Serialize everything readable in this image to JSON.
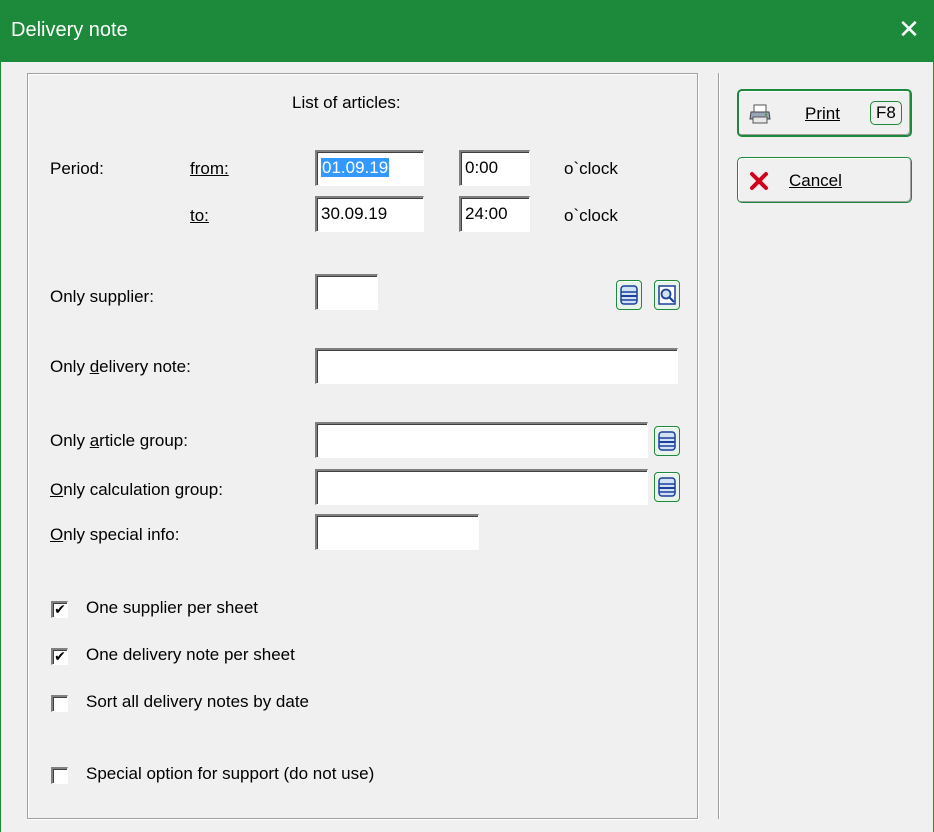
{
  "window": {
    "title": "Delivery note",
    "close_glyph": "✕"
  },
  "form": {
    "heading": "List of articles:",
    "period": {
      "label": "Period:",
      "from_label": "from:",
      "to_label": "to:",
      "from_date": "01.09.19",
      "from_time": "0:00",
      "to_date": "30.09.19",
      "to_time": "24:00",
      "unit": "o`clock"
    },
    "supplier": {
      "label": "Only supplier:",
      "value": ""
    },
    "delivery_note": {
      "label": "Only delivery note:",
      "value": ""
    },
    "article_group": {
      "label": "Only article group:",
      "value": ""
    },
    "calculation_group": {
      "label": "Only calculation group:",
      "value": ""
    },
    "special_info": {
      "label": "Only special info:",
      "value": ""
    },
    "options": [
      {
        "label": "One supplier per sheet",
        "checked": true
      },
      {
        "label": "One delivery note per sheet",
        "checked": true
      },
      {
        "label": "Sort all delivery notes by date",
        "checked": false
      },
      {
        "label": "Special option for support (do not use)",
        "checked": false
      }
    ]
  },
  "buttons": {
    "print": {
      "label": "Print",
      "shortcut": "F8"
    },
    "cancel": {
      "label": "Cancel"
    }
  },
  "icons": [
    "list-icon",
    "magnifier-icon",
    "printer-icon",
    "cancel-x-icon"
  ],
  "colors": {
    "titlebar": "#1c8a3a",
    "selection": "#3399ff",
    "cancel_x": "#d0021b"
  }
}
